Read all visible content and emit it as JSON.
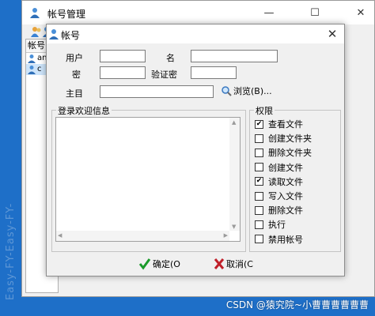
{
  "main_window": {
    "title": "帐号管理",
    "controls": {
      "minimize": "—",
      "maximize": "☐",
      "close": "✕"
    },
    "list": {
      "header": "帐号",
      "rows": [
        {
          "text": "an",
          "selected": false
        },
        {
          "text": "c",
          "selected": true
        }
      ]
    },
    "watermark": "Easy-FY-Easy-FY-"
  },
  "dialog": {
    "title": "帐号",
    "close": "✕",
    "fields": {
      "username_label": "用户",
      "username_value": "",
      "name_label": "名",
      "name_value": "",
      "password_label": "密",
      "password_value": "",
      "verify_label": "验证密",
      "verify_value": "",
      "homedir_label": "主目",
      "homedir_value": ""
    },
    "browse_label": "浏览(B)...",
    "welcome_group_label": "登录欢迎信息",
    "welcome_text": "",
    "permissions_group_label": "权限",
    "permissions": [
      {
        "label": "查看文件",
        "checked": true
      },
      {
        "label": "创建文件夹",
        "checked": false
      },
      {
        "label": "删除文件夹",
        "checked": false
      },
      {
        "label": "创建文件",
        "checked": false
      },
      {
        "label": "读取文件",
        "checked": true
      },
      {
        "label": "写入文件",
        "checked": false
      },
      {
        "label": "删除文件",
        "checked": false
      },
      {
        "label": "执行",
        "checked": false
      },
      {
        "label": "禁用帐号",
        "checked": false
      }
    ],
    "ok_label": "确定(O",
    "cancel_label": "取消(C"
  },
  "watermark": "CSDN @猿究院~小曹曹曹曹曹曹",
  "colors": {
    "desktop": "#1e6fc8",
    "ok_check": "#1a9a2a",
    "cancel_x": "#c0202a"
  }
}
